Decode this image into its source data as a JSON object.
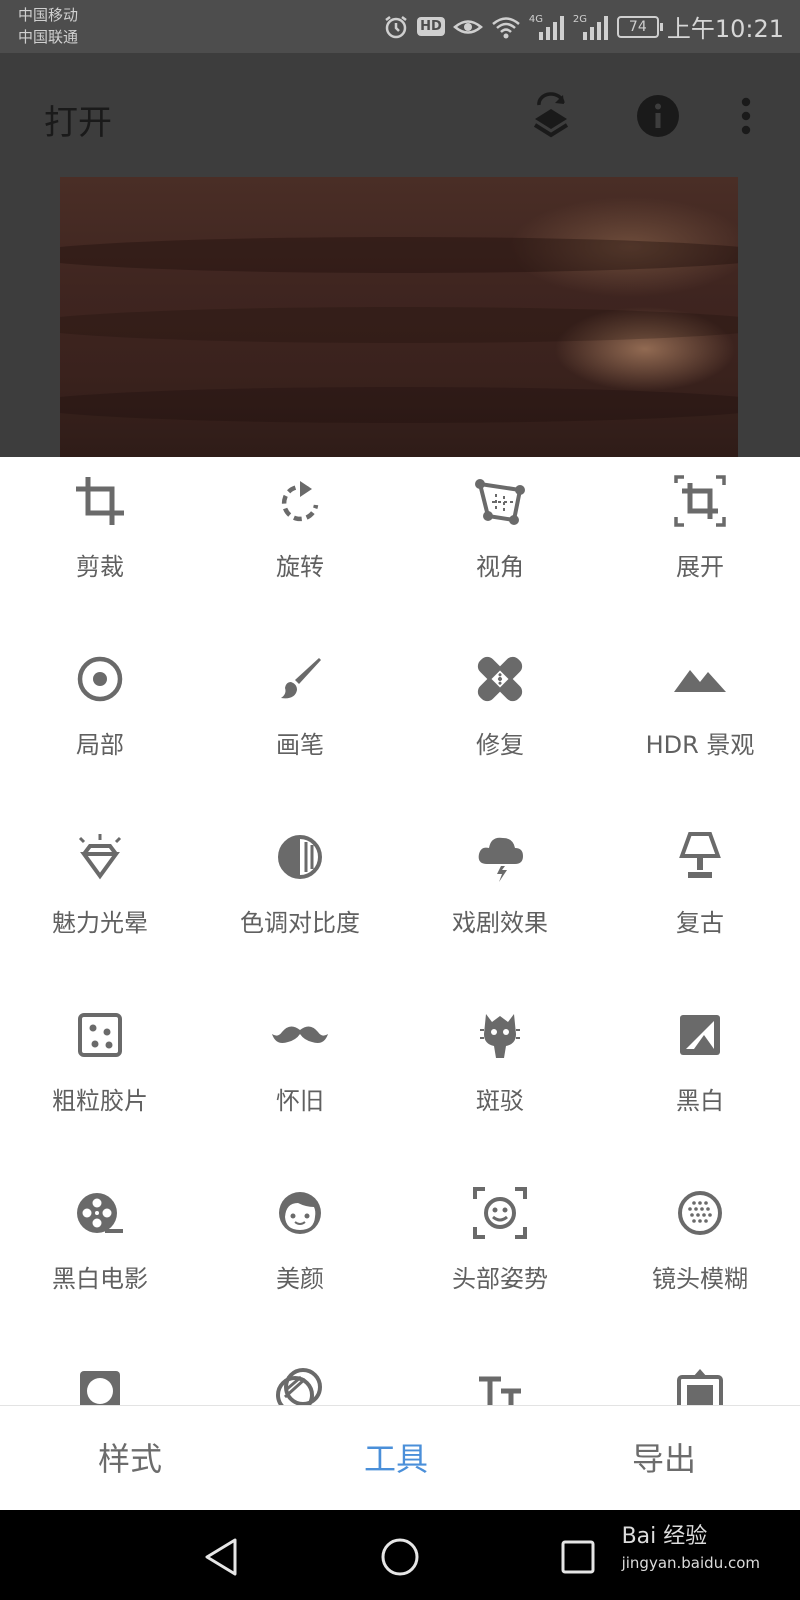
{
  "status_bar": {
    "carrier_1": "中国移动",
    "carrier_2": "中国联通",
    "net_4g": "4G",
    "net_2g": "2G",
    "hd": "HD",
    "battery": "74",
    "time": "上午10:21"
  },
  "app_bar": {
    "title": "打开",
    "icons": [
      "layers-refresh-icon",
      "info-icon",
      "more-vert-icon"
    ]
  },
  "tools": [
    {
      "label": "剪裁",
      "icon": "crop-icon"
    },
    {
      "label": "旋转",
      "icon": "rotate-icon"
    },
    {
      "label": "视角",
      "icon": "perspective-icon"
    },
    {
      "label": "展开",
      "icon": "expand-icon"
    },
    {
      "label": "局部",
      "icon": "selective-icon"
    },
    {
      "label": "画笔",
      "icon": "brush-icon"
    },
    {
      "label": "修复",
      "icon": "healing-icon"
    },
    {
      "label": "HDR 景观",
      "icon": "hdr-landscape-icon"
    },
    {
      "label": "魅力光晕",
      "icon": "glamour-glow-icon"
    },
    {
      "label": "色调对比度",
      "icon": "tonal-contrast-icon"
    },
    {
      "label": "戏剧效果",
      "icon": "drama-icon"
    },
    {
      "label": "复古",
      "icon": "vintage-lamp-icon"
    },
    {
      "label": "粗粒胶片",
      "icon": "grainy-film-icon"
    },
    {
      "label": "怀旧",
      "icon": "mustache-icon"
    },
    {
      "label": "斑驳",
      "icon": "grunge-icon"
    },
    {
      "label": "黑白",
      "icon": "black-white-icon"
    },
    {
      "label": "黑白电影",
      "icon": "film-reel-icon"
    },
    {
      "label": "美颜",
      "icon": "face-icon"
    },
    {
      "label": "头部姿势",
      "icon": "head-pose-icon"
    },
    {
      "label": "镜头模糊",
      "icon": "lens-blur-icon"
    },
    {
      "label": "",
      "icon": "vignette-icon"
    },
    {
      "label": "",
      "icon": "double-exposure-icon"
    },
    {
      "label": "",
      "icon": "text-icon"
    },
    {
      "label": "",
      "icon": "frames-icon"
    }
  ],
  "bottom_tabs": [
    {
      "label": "样式",
      "active": false
    },
    {
      "label": "工具",
      "active": true
    },
    {
      "label": "导出",
      "active": false
    }
  ],
  "colors": {
    "active_tab": "#4a8fd9",
    "icon_gray": "#6a6a6a",
    "label_gray": "#606060"
  },
  "watermark": {
    "brand": "Bai 经验",
    "url": "jingyan.baidu.com"
  }
}
